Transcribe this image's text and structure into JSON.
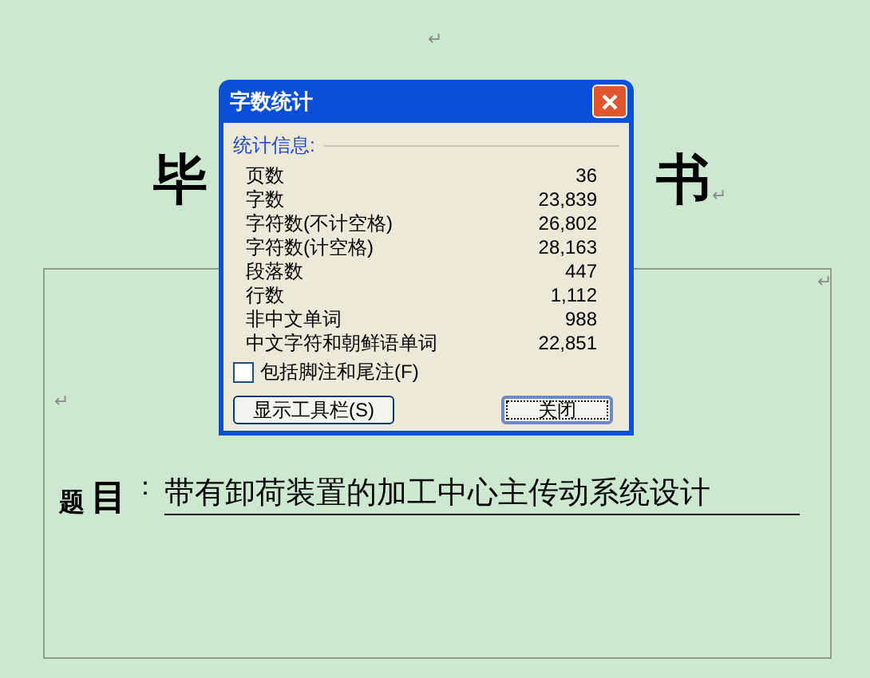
{
  "document": {
    "paragraph_marks": [
      "↵",
      "↵",
      "↵",
      "↵"
    ],
    "heading": {
      "left": "毕",
      "right": "书"
    },
    "title_line": {
      "label_1": "题",
      "label_2": "目",
      "colon": "：",
      "value": "带有卸荷装置的加工中心主传动系统设计"
    }
  },
  "dialog": {
    "title": "字数统计",
    "section": "统计信息:",
    "rows": [
      {
        "label": "页数",
        "value": "36"
      },
      {
        "label": "字数",
        "value": "23,839"
      },
      {
        "label": "字符数(不计空格)",
        "value": "26,802"
      },
      {
        "label": "字符数(计空格)",
        "value": "28,163"
      },
      {
        "label": "段落数",
        "value": "447"
      },
      {
        "label": "行数",
        "value": "1,112"
      },
      {
        "label": "非中文单词",
        "value": "988"
      },
      {
        "label": "中文字符和朝鲜语单词",
        "value": "22,851"
      }
    ],
    "checkbox": {
      "label": "包括脚注和尾注(F)",
      "checked": false
    },
    "buttons": [
      {
        "label": "显示工具栏(S)",
        "default": false
      },
      {
        "label": "关闭",
        "default": true
      }
    ]
  }
}
